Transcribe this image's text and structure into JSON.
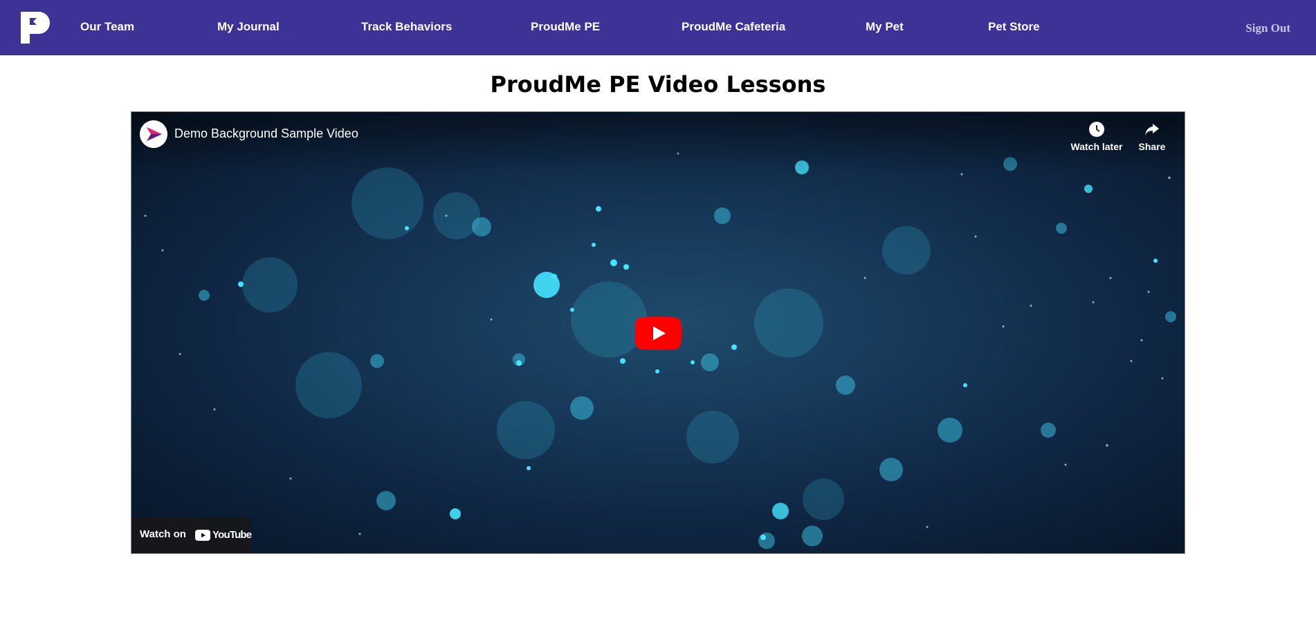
{
  "nav": {
    "items": [
      {
        "label": "Our Team"
      },
      {
        "label": "My Journal"
      },
      {
        "label": "Track Behaviors"
      },
      {
        "label": "ProudMe PE"
      },
      {
        "label": "ProudMe Cafeteria"
      },
      {
        "label": "My Pet"
      },
      {
        "label": "Pet Store"
      }
    ],
    "sign_out": "Sign Out",
    "logo_icon": "proudme-logo-icon",
    "color": "#3d3296"
  },
  "page": {
    "title": "ProudMe PE Video Lessons"
  },
  "video": {
    "title": "Demo Background Sample Video",
    "watch_later": "Watch later",
    "share": "Share",
    "watch_on": "Watch on",
    "youtube": "YouTube",
    "play_icon": "play-icon",
    "play_color": "#ff0000"
  }
}
